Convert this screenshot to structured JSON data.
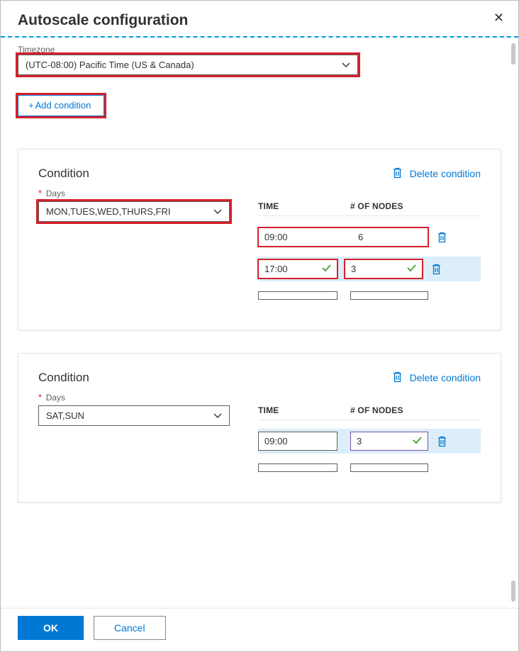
{
  "header": {
    "title": "Autoscale configuration"
  },
  "timezone": {
    "label": "Timezone",
    "value": "(UTC-08:00) Pacific Time (US & Canada)"
  },
  "add_condition": "Add condition",
  "delete_condition": "Delete condition",
  "days_label": "Days",
  "table": {
    "time": "TIME",
    "nodes": "# OF NODES"
  },
  "conditions": [
    {
      "title": "Condition",
      "days": "MON,TUES,WED,THURS,FRI",
      "rows": [
        {
          "time": "09:00",
          "nodes": "6",
          "time_valid": false,
          "nodes_valid": false,
          "selected": false,
          "combined": true,
          "highlight": "red"
        },
        {
          "time": "17:00",
          "nodes": "3",
          "time_valid": true,
          "nodes_valid": true,
          "selected": true,
          "highlight": "red"
        },
        {
          "time": "",
          "nodes": "",
          "selected": false
        }
      ],
      "days_highlight": true
    },
    {
      "title": "Condition",
      "days": "SAT,SUN",
      "rows": [
        {
          "time": "09:00",
          "nodes": "3",
          "nodes_valid": true,
          "selected": true,
          "nodes_border": "valid"
        },
        {
          "time": "",
          "nodes": "",
          "selected": false
        }
      ],
      "days_highlight": false
    }
  ],
  "footer": {
    "ok": "OK",
    "cancel": "Cancel"
  }
}
